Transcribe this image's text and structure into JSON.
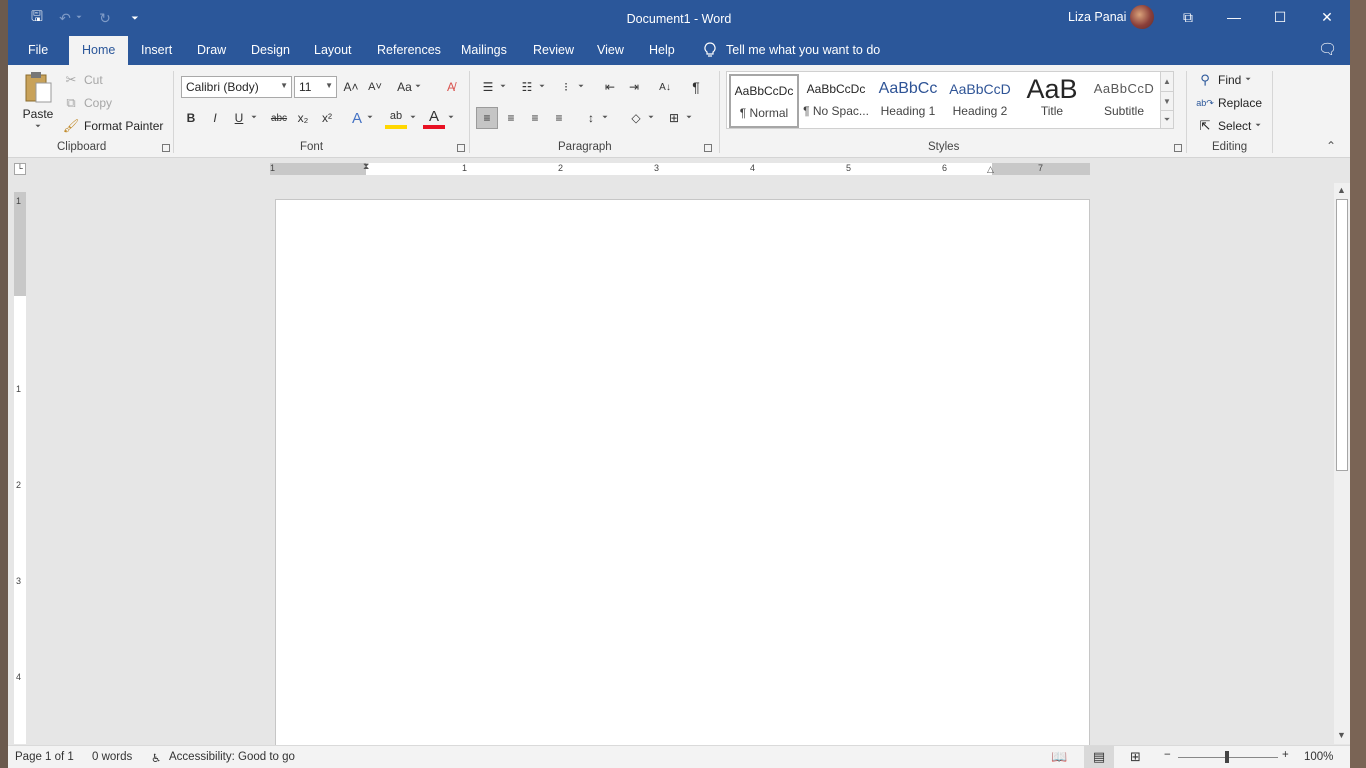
{
  "title_bar": {
    "doc_title": "Document1  -  Word",
    "user_name": "Liza Panai",
    "save_glyph": "🖫",
    "undo_glyph": "↶",
    "redo_glyph": "↻",
    "customize_glyph": "⏷",
    "ribbon_display_glyph": "⧉",
    "minimize_glyph": "—",
    "maximize_glyph": "☐",
    "close_glyph": "✕"
  },
  "tabs": {
    "file": "File",
    "home": "Home",
    "insert": "Insert",
    "draw": "Draw",
    "design": "Design",
    "layout": "Layout",
    "references": "References",
    "mailings": "Mailings",
    "review": "Review",
    "view": "View",
    "help": "Help",
    "tell_me": "Tell me what you want to do",
    "share_glyph": "🗨"
  },
  "clipboard": {
    "paste": "Paste",
    "cut": "Cut",
    "copy": "Copy",
    "format_painter": "Format Painter",
    "label": "Clipboard"
  },
  "font": {
    "name": "Calibri (Body)",
    "size": "11",
    "label": "Font",
    "grow": "A˄",
    "shrink": "A˅",
    "change_case": "Aa",
    "clear_format": "A̸",
    "bold": "B",
    "italic": "I",
    "underline": "U",
    "strikethrough": "abc",
    "subscript": "x₂",
    "superscript": "x²",
    "text_effects": "A",
    "highlight": "ab",
    "font_color": "A",
    "font_color_hex": "#e81123",
    "highlight_hex": "#ffd700"
  },
  "paragraph": {
    "label": "Paragraph",
    "bullets": "☰",
    "numbering": "☷",
    "multilevel": "⁝",
    "decrease_indent": "⇤",
    "increase_indent": "⇥",
    "sort": "A↓",
    "show_marks": "¶",
    "align_left": "≡",
    "center": "≡",
    "align_right": "≡",
    "justify": "≡",
    "line_spacing": "↕",
    "shading": "◇",
    "borders": "⊞"
  },
  "styles": {
    "label": "Styles",
    "items": [
      {
        "preview": "AaBbCcDc",
        "name": "¶ Normal"
      },
      {
        "preview": "AaBbCcDc",
        "name": "¶ No Spac..."
      },
      {
        "preview": "AaBbCc",
        "name": "Heading 1"
      },
      {
        "preview": "AaBbCcD",
        "name": "Heading 2"
      },
      {
        "preview": "AaB",
        "name": "Title"
      },
      {
        "preview": "AaBbCcD",
        "name": "Subtitle"
      }
    ],
    "heading_color": "#2f5496"
  },
  "editing": {
    "label": "Editing",
    "find": "Find",
    "replace": "Replace",
    "select": "Select"
  },
  "ruler": {
    "h_numbers": [
      "1",
      "1",
      "2",
      "3",
      "4",
      "5",
      "6",
      "7"
    ],
    "v_numbers": [
      "1",
      "1",
      "2",
      "3",
      "4"
    ]
  },
  "status_bar": {
    "page": "Page 1 of 1",
    "words": "0 words",
    "accessibility": "Accessibility: Good to go",
    "zoom": "100%",
    "zoom_out": "−",
    "zoom_in": "+"
  },
  "colors": {
    "accent": "#2b579a",
    "ribbon_bg": "#f3f3f3",
    "canvas_bg": "#e6e6e6"
  }
}
